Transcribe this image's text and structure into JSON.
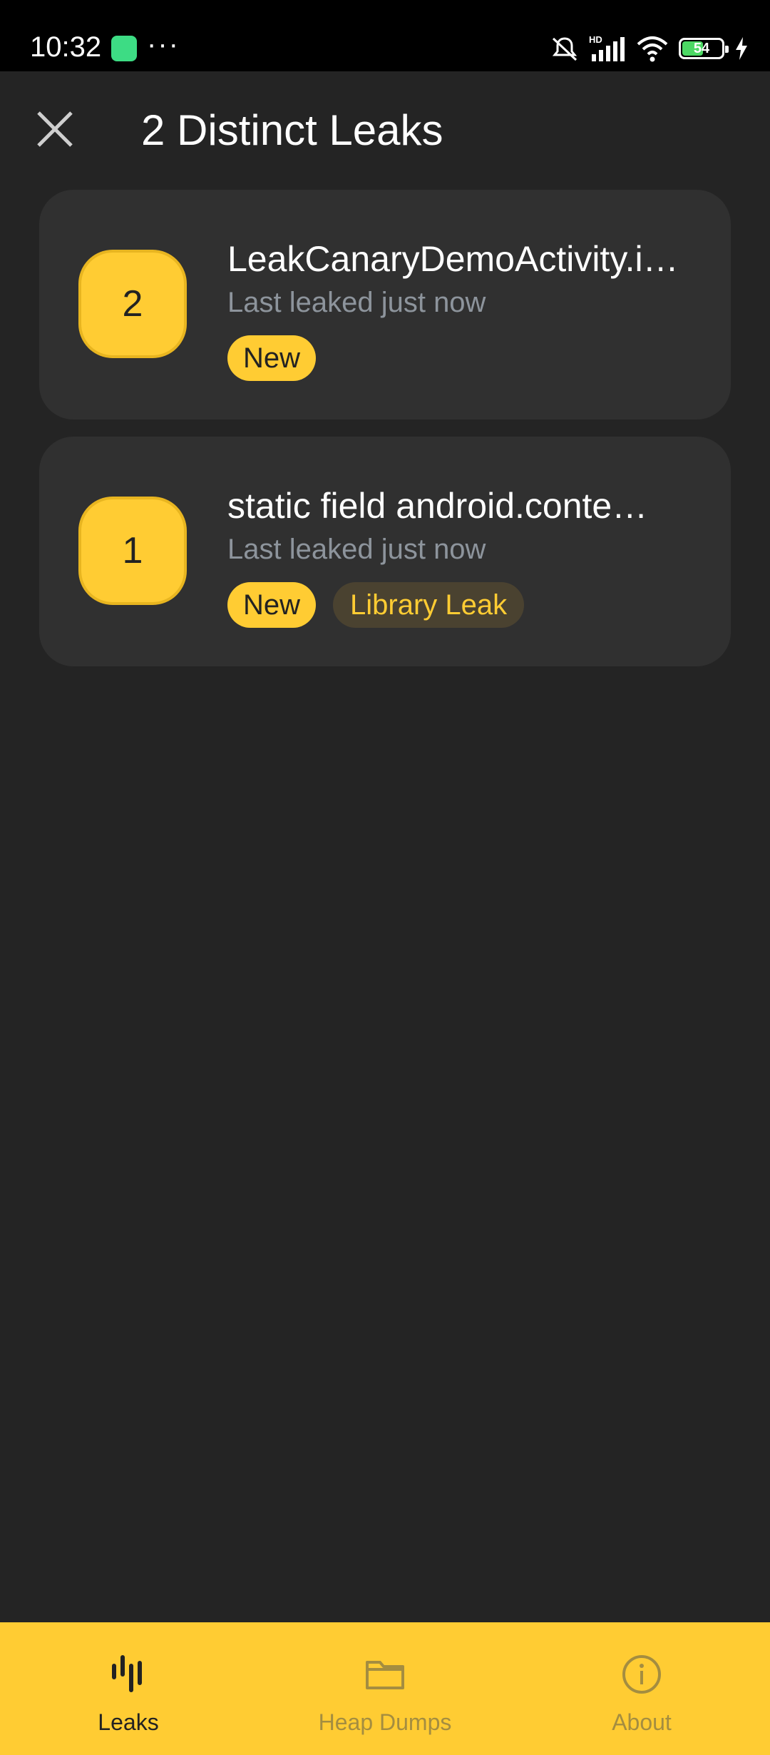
{
  "status_bar": {
    "time": "10:32",
    "dots": "···",
    "network_label": "HD",
    "battery_percent": "54",
    "battery_level": 0.54
  },
  "header": {
    "title": "2 Distinct Leaks",
    "close_icon": "close-icon"
  },
  "leaks": [
    {
      "count": "2",
      "title": "LeakCanaryDemoActivity.i…",
      "subtitle": "Last leaked just now",
      "tags": [
        "New"
      ]
    },
    {
      "count": "1",
      "title": "static field android.conte…",
      "subtitle": "Last leaked just now",
      "tags": [
        "New",
        "Library Leak"
      ]
    }
  ],
  "bottom_nav": {
    "items": [
      {
        "label": "Leaks",
        "icon": "leaks-icon",
        "active": true
      },
      {
        "label": "Heap Dumps",
        "icon": "folder-icon",
        "active": false
      },
      {
        "label": "About",
        "icon": "info-icon",
        "active": false
      }
    ]
  },
  "colors": {
    "background": "#242424",
    "card": "#303030",
    "accent": "#ffcc33",
    "subtitle": "#8d949c"
  }
}
